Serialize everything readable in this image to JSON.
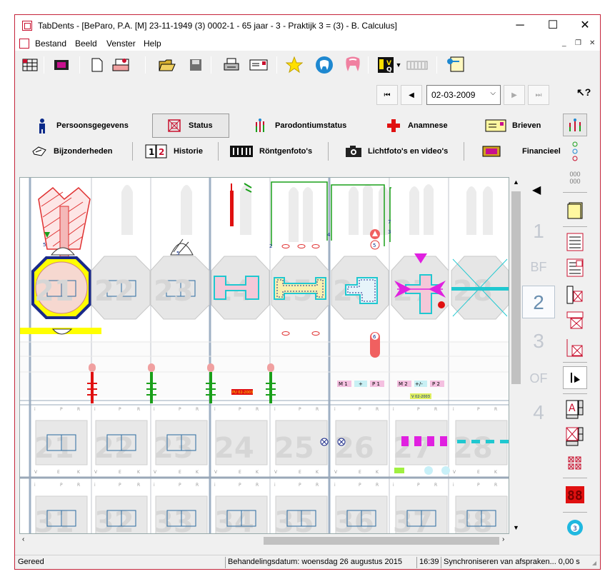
{
  "window": {
    "title": "TabDents - [BeParo, P.A. [M] 23-11-1949 (3) 0002-1 - 65 jaar - 3 - Praktijk 3 = (3) - B. Calculus]",
    "minimize": "─",
    "maximize": "☐",
    "close": "✕"
  },
  "menu": {
    "items": [
      "Bestand",
      "Beeld",
      "Venster",
      "Help"
    ]
  },
  "toolbar": {
    "icons": [
      "grid-icon",
      "film-icon",
      "new-document-icon",
      "teeth-stack-icon",
      "open-folder-icon",
      "save-icon",
      "print-icon",
      "envelope-icon",
      "star-icon",
      "tooth-blue-icon",
      "tooth-pink-icon",
      "vq-icon",
      "xray-icon",
      "key-icon"
    ]
  },
  "navigation": {
    "date": "02-03-2009",
    "first": "⏮",
    "prev": "◀",
    "next": "▶",
    "last": "⏭",
    "help": "↖?"
  },
  "tabs_row1": [
    {
      "label": "Persoonsgegevens",
      "icon": "person-icon"
    },
    {
      "label": "Status",
      "icon": "status-icon",
      "active": true
    },
    {
      "label": "Parodontiumstatus",
      "icon": "parodontium-icon"
    },
    {
      "label": "Anamnese",
      "icon": "red-cross-icon"
    },
    {
      "label": "Brieven",
      "icon": "letter-icon"
    }
  ],
  "tabs_row2": [
    {
      "label": "Bijzonderheden",
      "icon": "hand-icon"
    },
    {
      "label": "Historie",
      "icon": "history-icon"
    },
    {
      "label": "Röntgenfoto's",
      "icon": "xray-film-icon"
    },
    {
      "label": "Lichtfoto's en video's",
      "icon": "camera-icon"
    },
    {
      "label": "Financieel",
      "icon": "money-icon"
    }
  ],
  "side_numbers": [
    "1",
    "BF",
    "2",
    "3",
    "OF",
    "4"
  ],
  "side_selected": "2",
  "teeth_upper": [
    "21",
    "22",
    "23",
    "24",
    "25",
    "26",
    "27",
    "28"
  ],
  "teeth_lower_a": [
    "21",
    "22",
    "23",
    "24",
    "25",
    "26",
    "27",
    "28"
  ],
  "teeth_lower_b": [
    "31",
    "32",
    "33",
    "34",
    "35",
    "36",
    "37",
    "38"
  ],
  "chart_labels": {
    "m1": "M 1",
    "plus": "+",
    "p1": "P 1",
    "m2": "M 2",
    "plusmin": "+/-",
    "p2": "P 2",
    "pu": "PU 02-2003",
    "v": "V 02-2003",
    "badge_5a": "5",
    "badge_5b": "5",
    "badge_6": "6",
    "small_2": "2",
    "small_4": "4",
    "small_7": "7",
    "small_3": "3"
  },
  "status": {
    "ready": "Gereed",
    "treatment_date": "Behandelingsdatum: woensdag 26 augustus 2015",
    "time": "16:39",
    "sync": "Synchroniseren van afspraken... 0,00 s"
  },
  "colors": {
    "accent_red": "#c8102e",
    "teal": "#20c8d0",
    "magenta": "#e020e0",
    "yellow": "#ffff00",
    "green": "#1aa01a"
  }
}
